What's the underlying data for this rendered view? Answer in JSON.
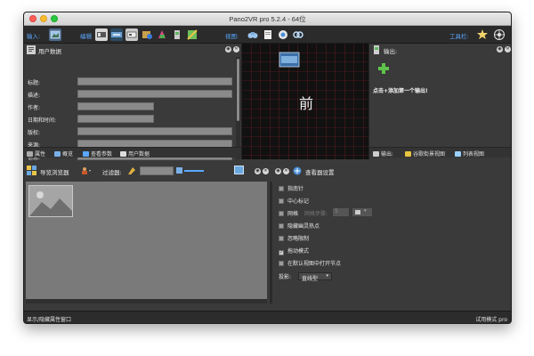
{
  "window": {
    "title": "Pano2VR pro 5.2.4 - 64位"
  },
  "toolbar": {
    "input_label": "输入:",
    "edit_label": "编辑",
    "view_label": "视图:",
    "tools_label": "工具栏:"
  },
  "user_data_panel": {
    "title": "用户数据",
    "fields": [
      {
        "label": "标题:",
        "value": ""
      },
      {
        "label": "描述:",
        "value": ""
      },
      {
        "label": "作者:",
        "value": ""
      },
      {
        "label": "日期和时间:",
        "value": ""
      },
      {
        "label": "版权:",
        "value": ""
      },
      {
        "label": "来源:",
        "value": ""
      },
      {
        "label": "信息:",
        "value": ""
      }
    ],
    "tabs": [
      "属性",
      "概览",
      "查看参数",
      "用户数据"
    ]
  },
  "viewer": {
    "center_text": "前"
  },
  "output_panel": {
    "title": "输出:",
    "hint": "点击+添加第一个输出!",
    "tabs": [
      "输出:",
      "谷歌街景视图",
      "列表视图"
    ]
  },
  "tour_browser": {
    "title": "导览浏览器",
    "filter_label": "过滤器:"
  },
  "viewer_settings": {
    "title": "查看器设置",
    "options": [
      {
        "label": "指南针",
        "checked": false
      },
      {
        "label": "中心标记",
        "checked": false
      },
      {
        "label": "网格",
        "checked": false
      },
      {
        "label": "隐藏幽灵热点",
        "checked": false
      },
      {
        "label": "忽略限制",
        "checked": false
      },
      {
        "label": "拖动模式",
        "checked": true
      },
      {
        "label": "在默认视图中打开节点",
        "checked": false
      }
    ],
    "grid_step_label": "网格步骤:",
    "grid_step_value": "5",
    "projection_label": "投影:",
    "projection_value": "直线型"
  },
  "statusbar": {
    "left_text": "显示/隐藏属性窗口",
    "right_text": "试用模式 pro"
  },
  "colors": {
    "accent": "#5aa8ff",
    "panel_bg": "#3a3a3a",
    "viewer_grid": "#8a1e2a"
  }
}
